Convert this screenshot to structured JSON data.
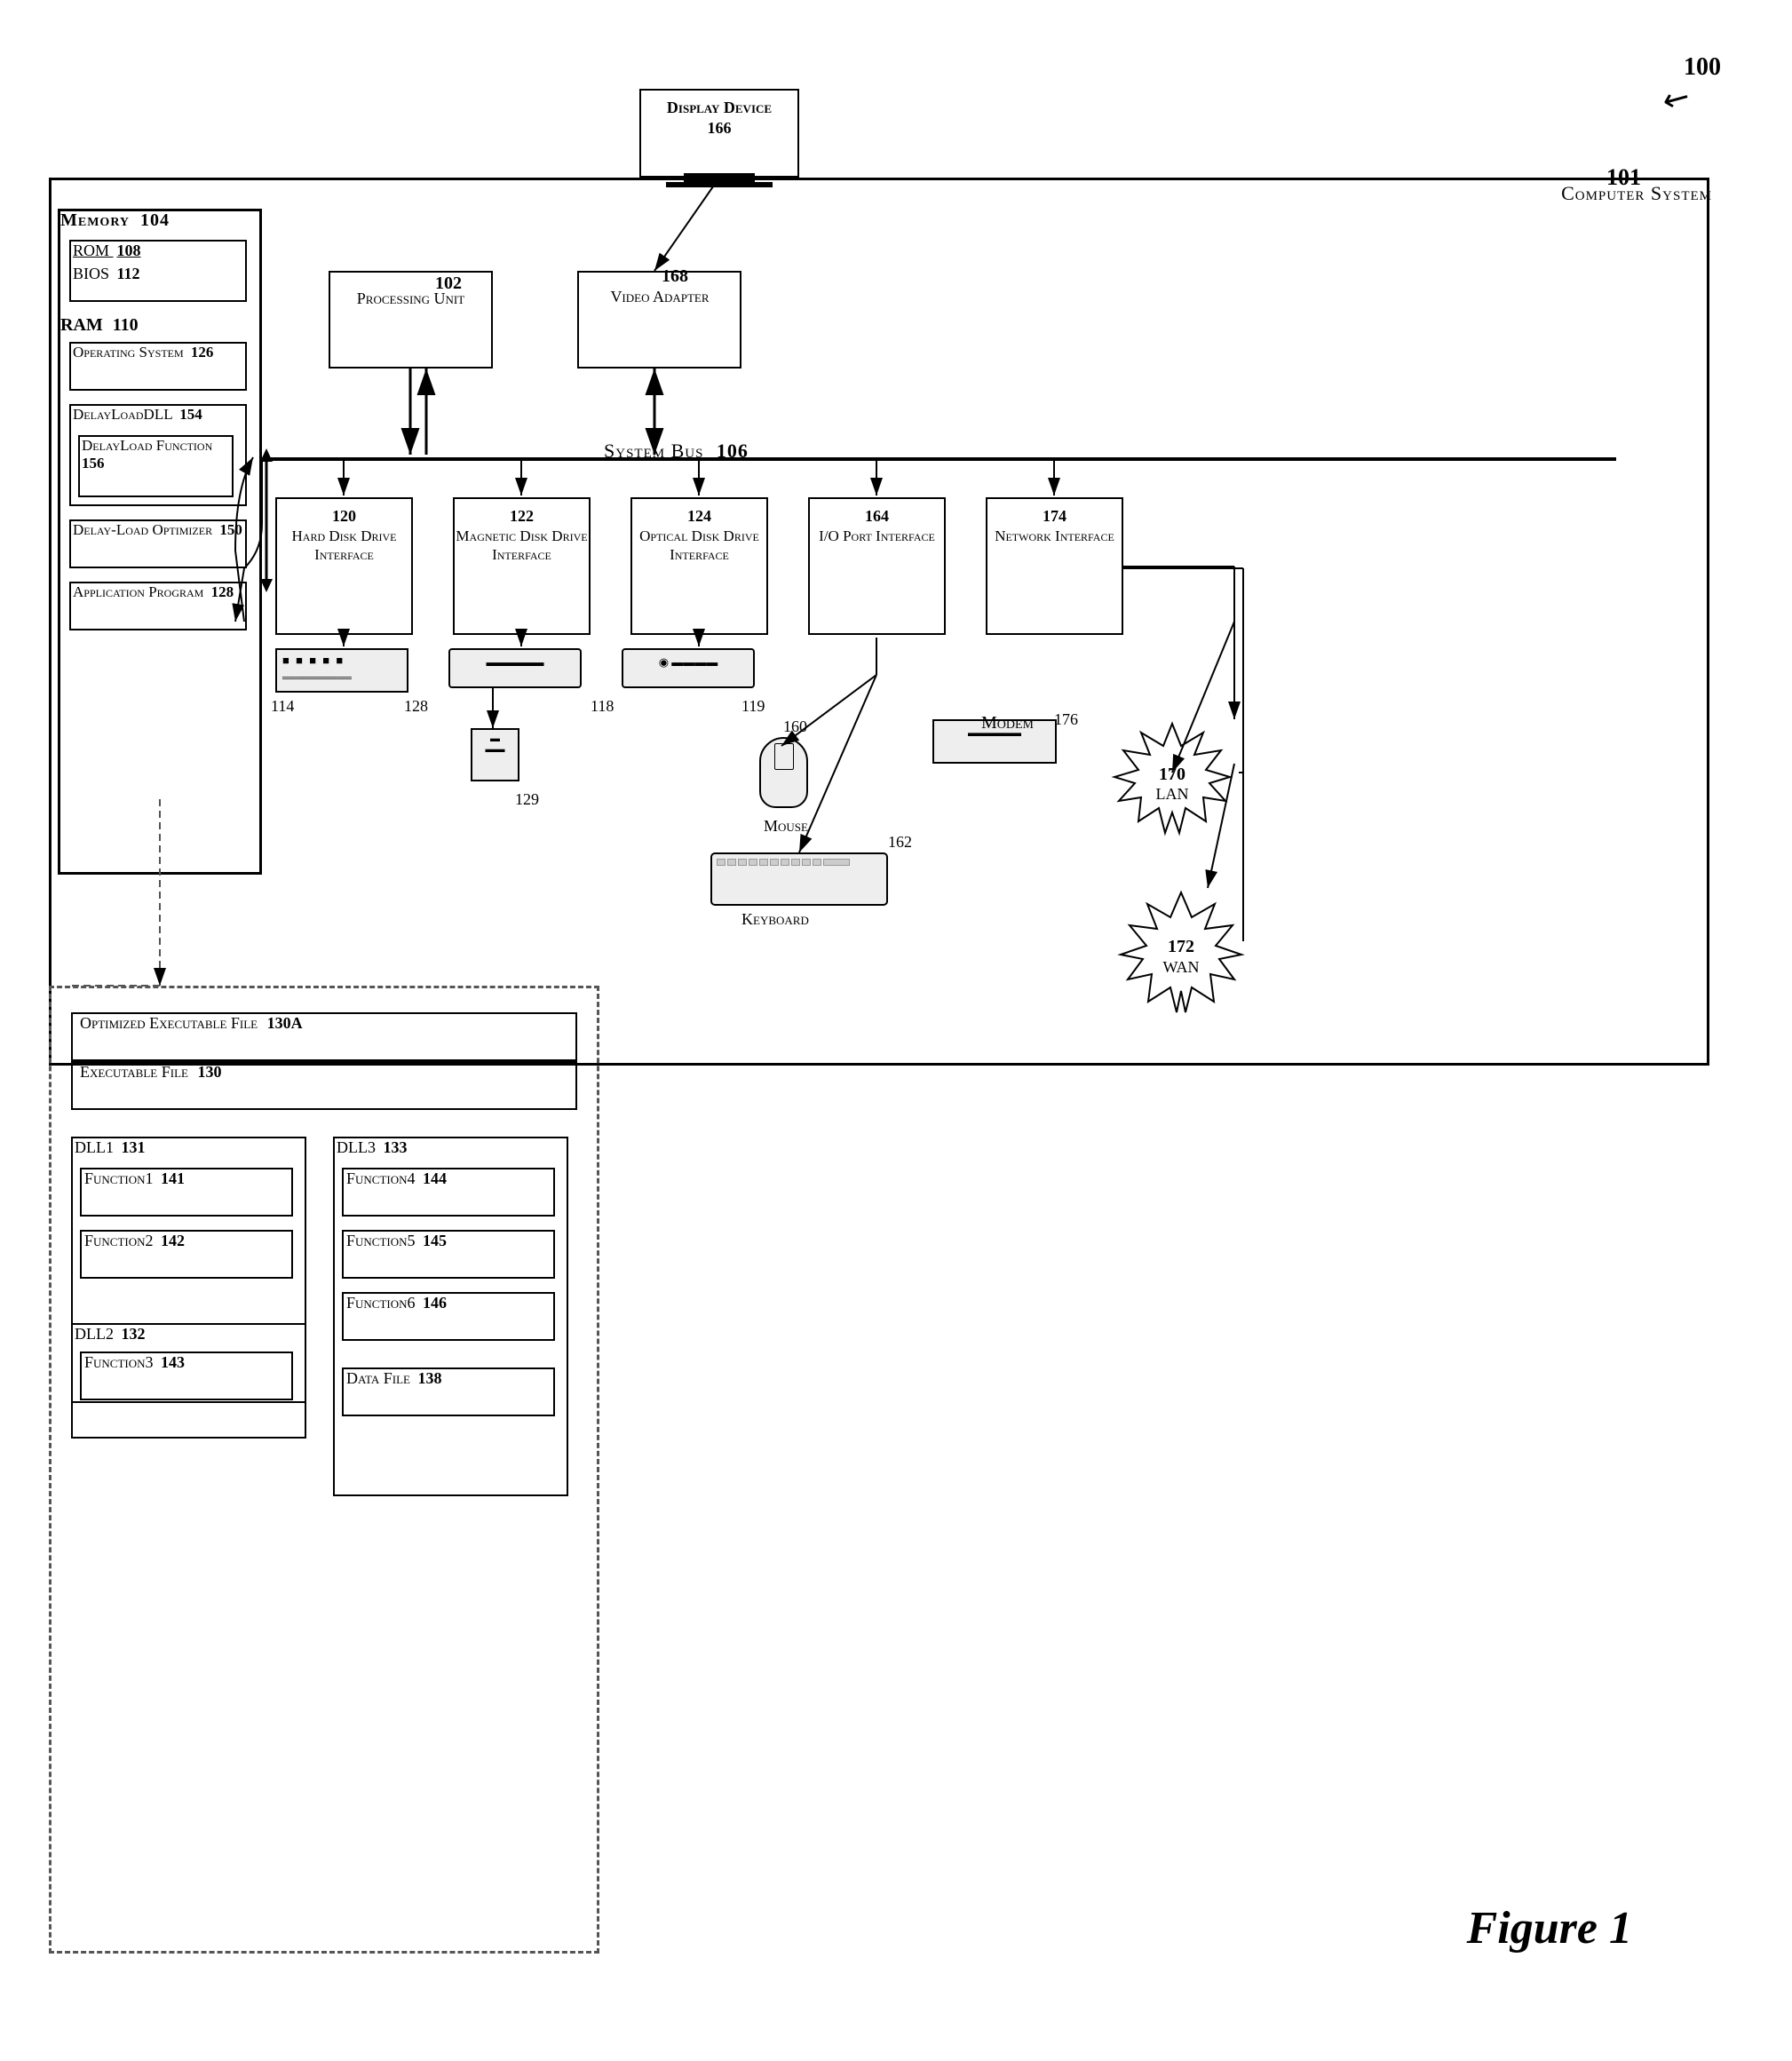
{
  "diagram": {
    "title": "Figure 1",
    "ref_number": "100",
    "computer_system": {
      "label": "Computer System",
      "number": "101"
    },
    "display_device": {
      "label": "Display Device",
      "number": "166"
    },
    "memory": {
      "label": "Memory",
      "number": "104",
      "rom": {
        "label": "ROM",
        "number": "108"
      },
      "bios": {
        "label": "BIOS",
        "number": "112"
      },
      "ram": {
        "label": "RAM",
        "number": "110"
      },
      "os": {
        "label": "Operating System",
        "number": "126"
      },
      "delayloaddll": {
        "label": "DelayLoadDLL",
        "number": "154"
      },
      "delayloadfn": {
        "label": "DelayLoad Function",
        "number": "156"
      },
      "dlo": {
        "label": "Delay-Load Optimizer",
        "number": "150"
      },
      "app": {
        "label": "Application Program",
        "number": "128"
      }
    },
    "processing_unit": {
      "label": "Processing Unit",
      "number": "102"
    },
    "video_adapter": {
      "label": "Video Adapter",
      "number": "168"
    },
    "system_bus": {
      "label": "System Bus",
      "number": "106"
    },
    "interfaces": {
      "hdd": {
        "label": "Hard Disk Drive Interface",
        "number": "120"
      },
      "mdd": {
        "label": "Magnetic Disk Drive Interface",
        "number": "122"
      },
      "odd": {
        "label": "Optical Disk Drive Interface",
        "number": "124"
      },
      "io": {
        "label": "I/O Port Interface",
        "number": "164"
      },
      "net": {
        "label": "Network Interface",
        "number": "174"
      }
    },
    "drives": {
      "hdd": {
        "number": "114"
      },
      "mag": {
        "number": "128"
      },
      "opt": {
        "number": "118"
      },
      "opt2": {
        "number": "119"
      },
      "floppy": {
        "number": "129"
      }
    },
    "peripherals": {
      "mouse": {
        "label": "Mouse",
        "number": "160"
      },
      "keyboard": {
        "label": "Keyboard",
        "number": "162"
      },
      "modem": {
        "label": "Modem",
        "number": "176"
      },
      "lan": {
        "label": "LAN",
        "number": "170"
      },
      "wan": {
        "label": "WAN",
        "number": "172"
      }
    },
    "expanded": {
      "oef": {
        "label": "Optimized Executable File",
        "number": "130A"
      },
      "ef": {
        "label": "Executable File",
        "number": "130"
      },
      "dll1": {
        "label": "DLL1",
        "number": "131"
      },
      "fn1": {
        "label": "Function1",
        "number": "141"
      },
      "fn2": {
        "label": "Function2",
        "number": "142"
      },
      "dll2": {
        "label": "DLL2",
        "number": "132"
      },
      "fn3": {
        "label": "Function3",
        "number": "143"
      },
      "dll3": {
        "label": "DLL3",
        "number": "133"
      },
      "fn4": {
        "label": "Function4",
        "number": "144"
      },
      "fn5": {
        "label": "Function5",
        "number": "145"
      },
      "fn6": {
        "label": "Function6",
        "number": "146"
      },
      "df": {
        "label": "Data File",
        "number": "138"
      }
    }
  }
}
